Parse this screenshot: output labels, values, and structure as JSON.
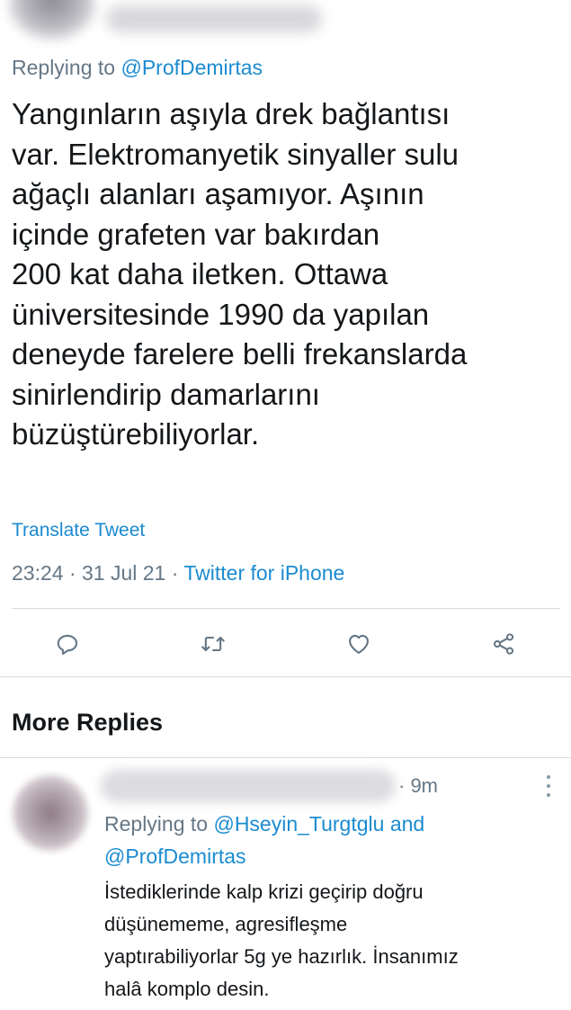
{
  "tweet": {
    "replying_prefix": "Replying to",
    "replying_handle": "@ProfDemirtas",
    "text_lines": [
      "Yangınların aşıyla drek bağlantısı",
      "var. Elektromanyetik sinyaller sulu",
      "ağaçlı alanları aşamıyor. Aşının",
      "içinde grafeten var bakırdan",
      "200 kat daha iletken. Ottawa",
      "üniversitesinde 1990 da yapılan",
      "deneyde farelere belli frekanslarda",
      "sinirlendirip damarlarını",
      "büzüştürebiliyorlar."
    ],
    "translate_label": "Translate Tweet",
    "timestamp": "23:24 · 31 Jul 21 · ",
    "source": "Twitter for iPhone"
  },
  "actions": {
    "icons": [
      "reply-icon",
      "retweet-icon",
      "like-icon",
      "share-icon"
    ]
  },
  "more_replies": {
    "heading": "More Replies"
  },
  "reply": {
    "time": "· 9m",
    "replying_prefix": "Replying to",
    "handle_1": "@Hseyin_Turgtglu",
    "conjunction": "and",
    "handle_2": "@ProfDemirtas",
    "text_lines": [
      "İstediklerinde kalp krizi geçirip doğru",
      "düşünememe, agresifleşme",
      "yaptırabiliyorlar 5g ye hazırlık. İnsanımız",
      "halâ komplo desin."
    ]
  },
  "colors": {
    "link": "#1b8bd0",
    "muted": "#657786",
    "text": "#14171a",
    "divider": "#d4dbe0",
    "icon": "#657786"
  }
}
